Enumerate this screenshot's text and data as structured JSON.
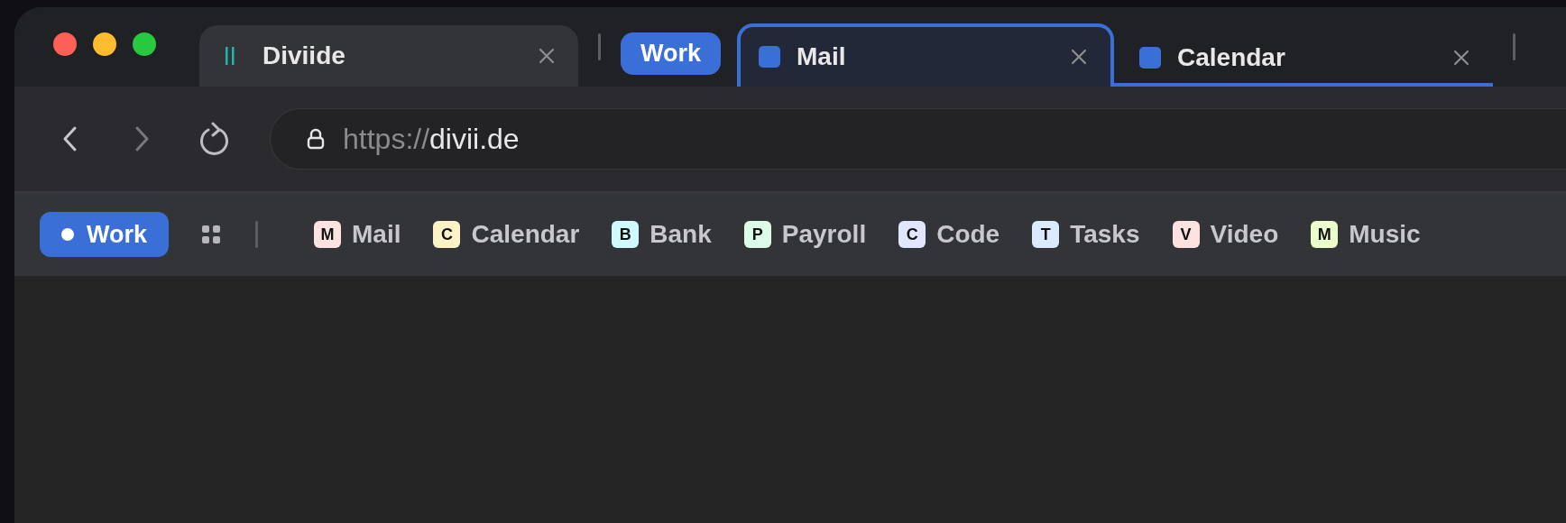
{
  "tabs": [
    {
      "title": "Diviide",
      "selected": false
    }
  ],
  "tab_group": {
    "label": "Work",
    "tabs": [
      {
        "title": "Mail",
        "selected": true
      },
      {
        "title": "Calendar",
        "selected": false
      }
    ]
  },
  "address_bar": {
    "scheme": "https://",
    "host": "divii.de"
  },
  "bookmarks_bar": {
    "space": {
      "label": "Work"
    },
    "bookmarks": [
      {
        "letter": "M",
        "label": "Mail",
        "color": "#fde2e2"
      },
      {
        "letter": "C",
        "label": "Calendar",
        "color": "#fef3c7"
      },
      {
        "letter": "B",
        "label": "Bank",
        "color": "#cffafe"
      },
      {
        "letter": "P",
        "label": "Payroll",
        "color": "#dcfce7"
      },
      {
        "letter": "C",
        "label": "Code",
        "color": "#e0e7ff"
      },
      {
        "letter": "T",
        "label": "Tasks",
        "color": "#dbeafe"
      },
      {
        "letter": "V",
        "label": "Video",
        "color": "#fee2e2"
      },
      {
        "letter": "M",
        "label": "Music",
        "color": "#ecfccb"
      }
    ]
  }
}
